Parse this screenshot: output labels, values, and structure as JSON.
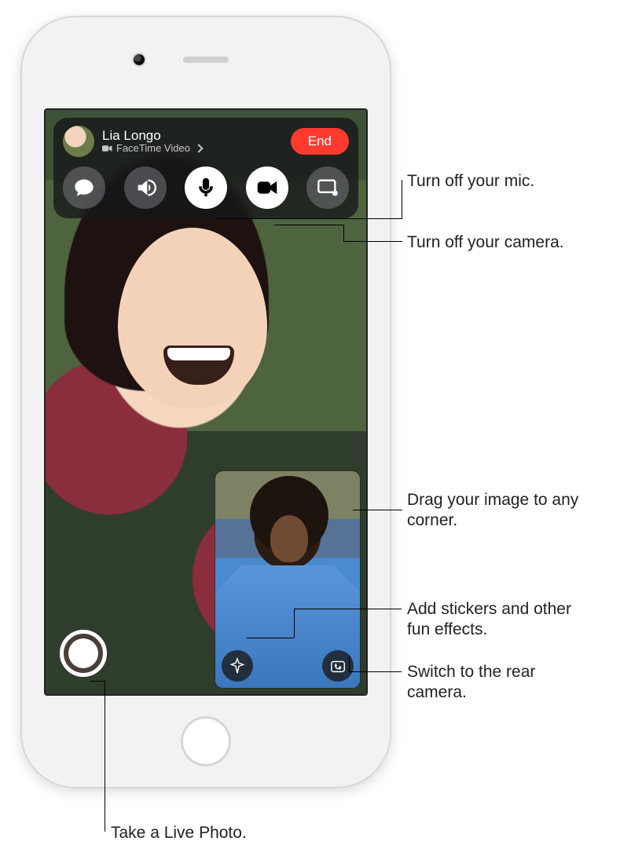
{
  "device": {
    "type": "ipod-touch"
  },
  "call": {
    "caller_name": "Lia Longo",
    "status_line": "FaceTime Video",
    "end_label": "End"
  },
  "controls": {
    "messages": "messages",
    "speaker": "speaker",
    "mute": "mute",
    "camera": "camera-off",
    "share": "share-screen"
  },
  "pip": {
    "effects_label": "effects",
    "flip_label": "flip-camera"
  },
  "shutter": {
    "aria": "Take Live Photo"
  },
  "callouts": {
    "mic": "Turn off your mic.",
    "camera": "Turn off your camera.",
    "drag": "Drag your image to any corner.",
    "effects": "Add stickers and other fun effects.",
    "flip": "Switch to the rear camera.",
    "shutter": "Take a Live Photo."
  }
}
